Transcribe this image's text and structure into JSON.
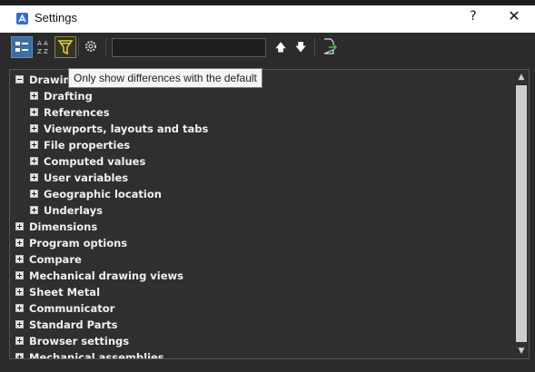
{
  "window": {
    "title": "Settings",
    "help_label": "?",
    "close_label": "✕"
  },
  "toolbar": {
    "search": {
      "value": "",
      "placeholder": ""
    },
    "move_up_label": "🡅",
    "move_down_label": "🡇",
    "icons": [
      "categorized-view-icon",
      "sort-alphabetical-icon",
      "filter-differences-icon",
      "gear-icon",
      "export-icon"
    ]
  },
  "tooltip": {
    "text": "Only show differences with the default"
  },
  "tree": {
    "items": [
      {
        "label": "Drawing",
        "expanded": true
      },
      {
        "label": "Drafting",
        "expanded": false
      },
      {
        "label": "References",
        "expanded": false
      },
      {
        "label": "Viewports, layouts and tabs",
        "expanded": false
      },
      {
        "label": "File properties",
        "expanded": false
      },
      {
        "label": "Computed values",
        "expanded": false
      },
      {
        "label": "User variables",
        "expanded": false
      },
      {
        "label": "Geographic location",
        "expanded": false
      },
      {
        "label": "Underlays",
        "expanded": false
      },
      {
        "label": "Dimensions",
        "expanded": false
      },
      {
        "label": "Program options",
        "expanded": false
      },
      {
        "label": "Compare",
        "expanded": false
      },
      {
        "label": "Mechanical drawing views",
        "expanded": false
      },
      {
        "label": "Sheet Metal",
        "expanded": false
      },
      {
        "label": "Communicator",
        "expanded": false
      },
      {
        "label": "Standard Parts",
        "expanded": false
      },
      {
        "label": "Browser settings",
        "expanded": false
      },
      {
        "label": "Mechanical assemblies",
        "expanded": false
      }
    ]
  },
  "colors": {
    "background": "#2b2b2b",
    "active_button": "#3d6fa3",
    "filter_icon": "#e2d338"
  }
}
